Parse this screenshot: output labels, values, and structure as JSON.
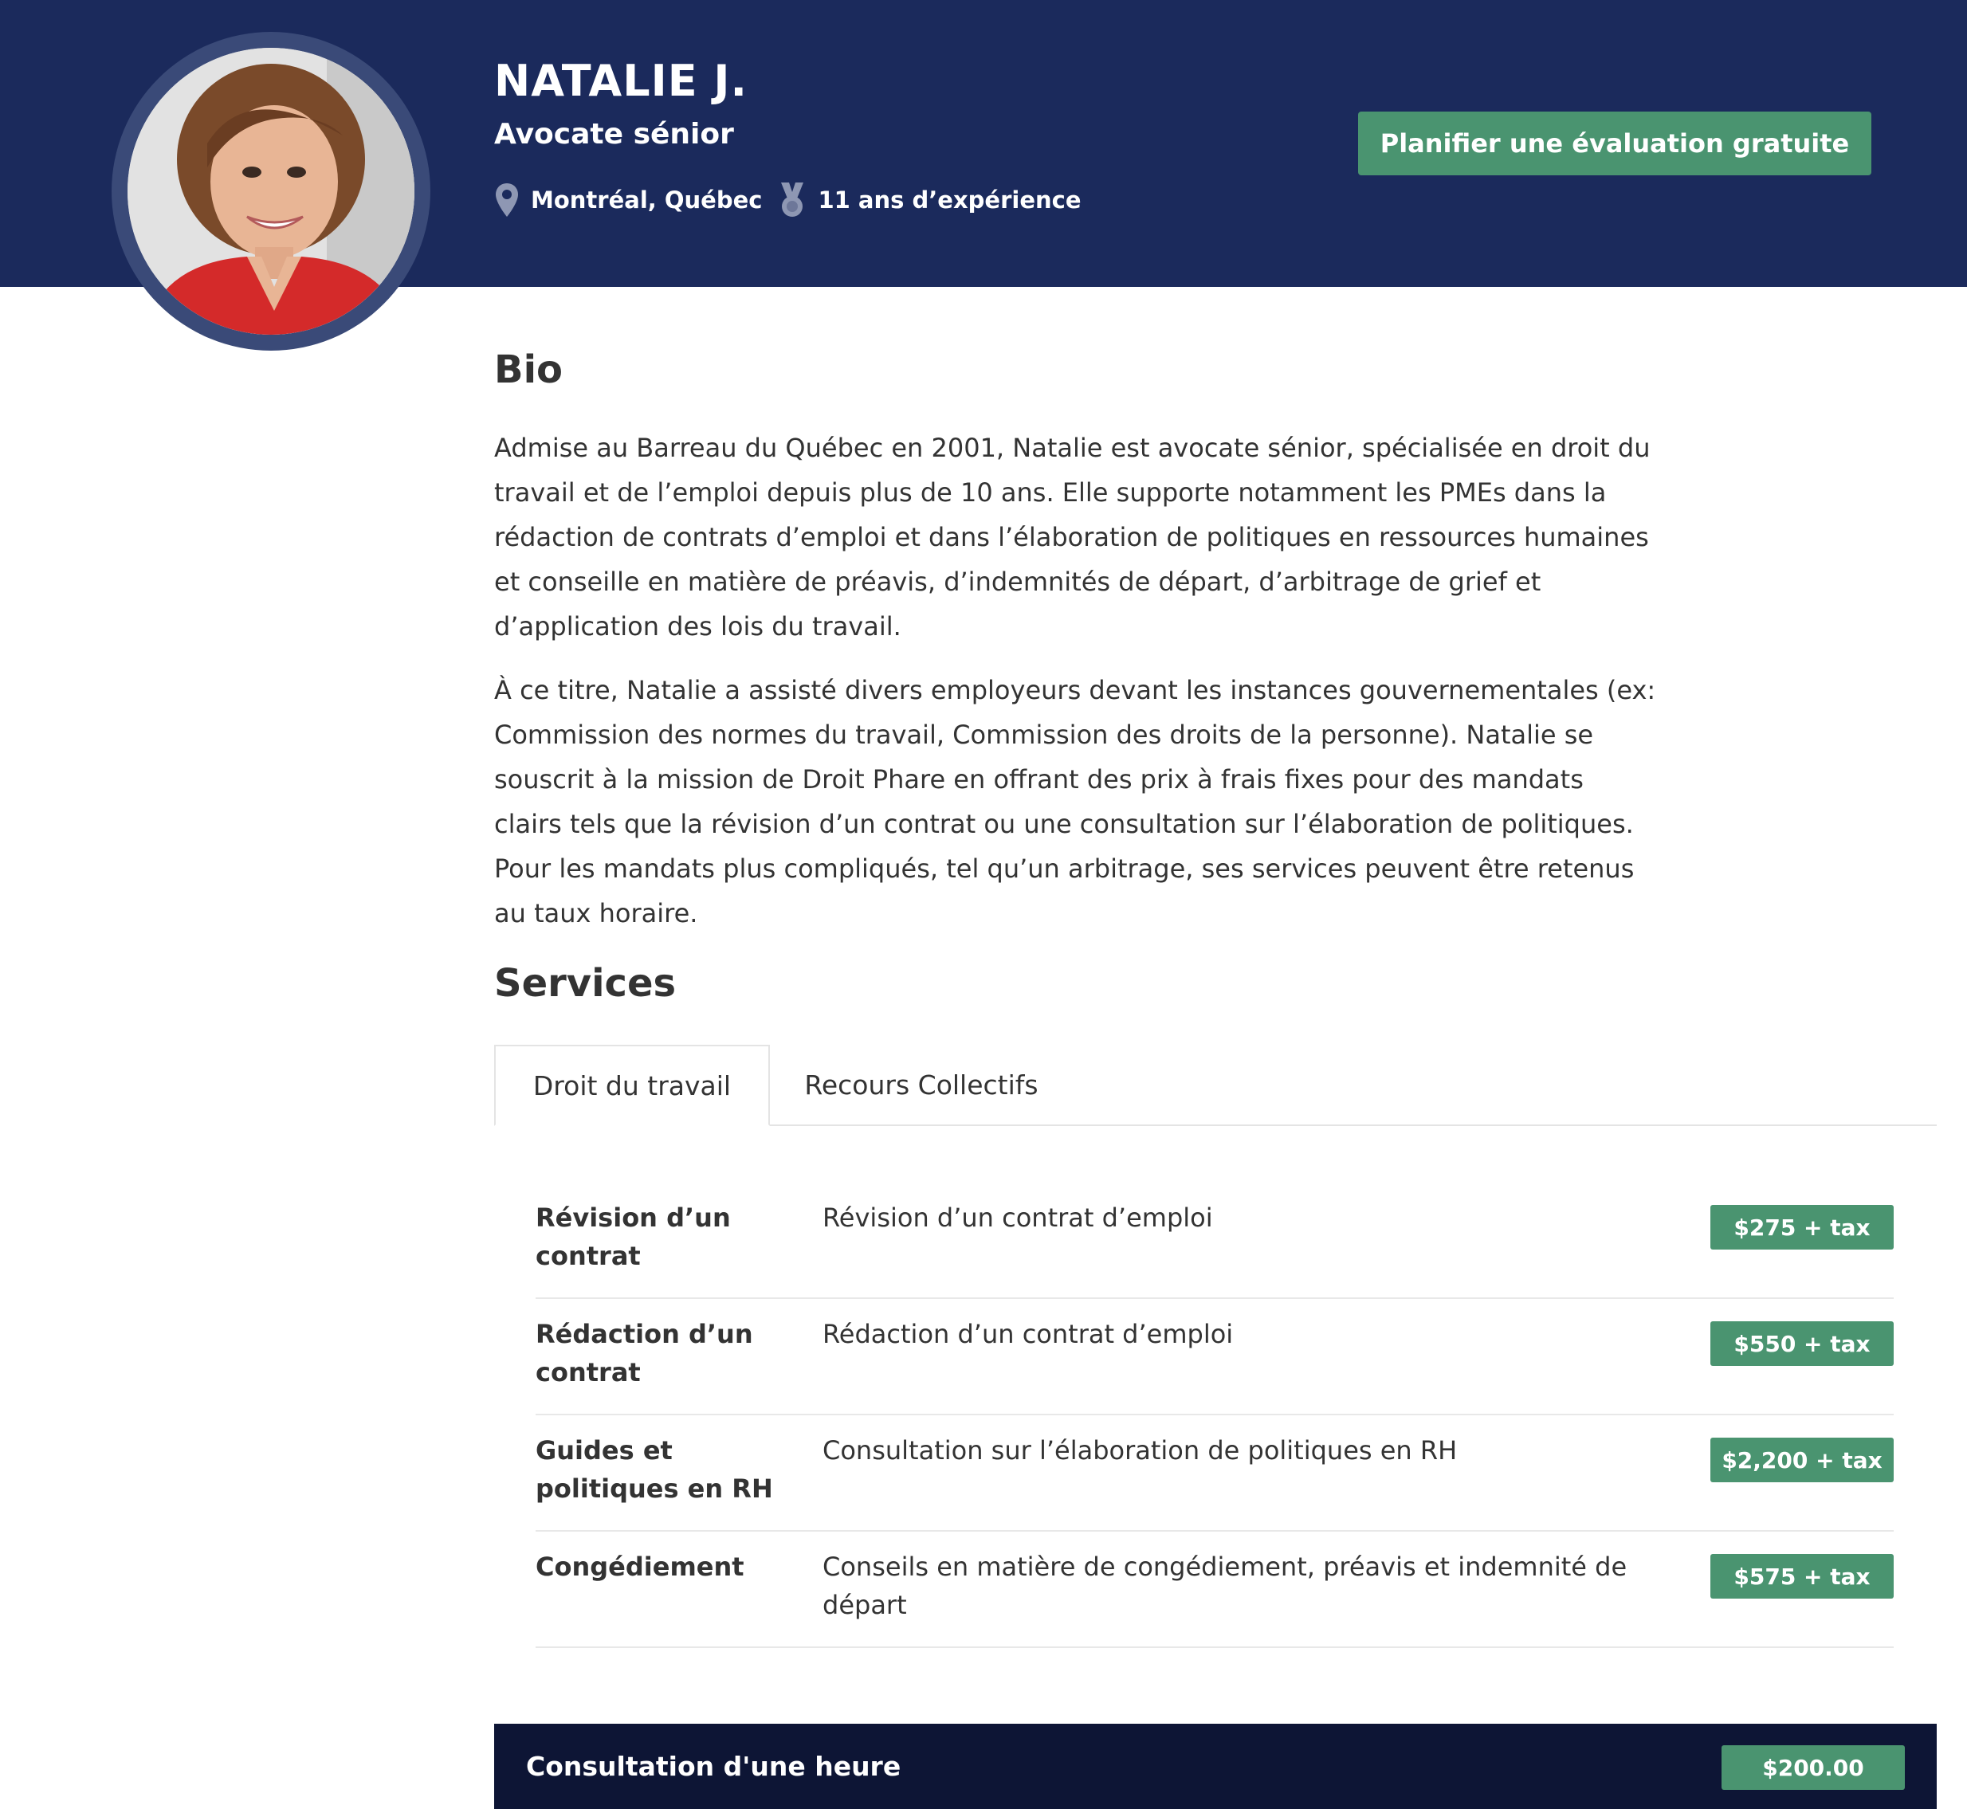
{
  "profile": {
    "name": "NATALIE J.",
    "title": "Avocate sénior",
    "location": "Montréal, Québec",
    "experience": "11 ans d’expérience",
    "cta_label": "Planifier une évaluation gratuite",
    "photo_icon": "avatar-photo",
    "location_icon": "map-pin-icon",
    "experience_icon": "medal-icon"
  },
  "bio": {
    "heading": "Bio",
    "paragraphs": [
      "Admise au Barreau du Québec en 2001, Natalie est avocate sénior, spécialisée en droit du travail et de l’emploi depuis plus de 10 ans. Elle supporte notamment les PMEs dans la rédaction de contrats d’emploi et dans l’élaboration de politiques en ressources humaines et conseille en matière de préavis, d’indemnités de départ, d’arbitrage de grief et d’application des lois du travail.",
      "À ce titre, Natalie a assisté divers employeurs devant les instances gouvernementales (ex: Commission des normes du travail, Commission des droits de la personne). Natalie se souscrit à la mission de Droit Phare en offrant des prix à frais fixes pour des mandats clairs tels que la révision d’un contrat ou une consultation sur l’élaboration de politiques. Pour les mandats plus compliqués, tel qu’un arbitrage, ses services peuvent être retenus au taux horaire."
    ]
  },
  "services": {
    "heading": "Services",
    "tabs": [
      {
        "label": "Droit du travail",
        "active": true
      },
      {
        "label": "Recours Collectifs",
        "active": false
      }
    ],
    "rows": [
      {
        "name": "Révision d’un contrat",
        "description": "Révision d’un contrat d’emploi",
        "price": "$275 + tax"
      },
      {
        "name": "Rédaction d’un contrat",
        "description": "Rédaction d’un contrat d’emploi",
        "price": "$550 + tax"
      },
      {
        "name": "Guides et politiques en RH",
        "description": "Consultation sur l’élaboration de politiques en RH",
        "price": "$2,200 + tax"
      },
      {
        "name": "Congédiement",
        "description": "Conseils en matière de congédiement, préavis et indemnité de départ",
        "price": "$575 + tax"
      }
    ]
  },
  "consultation": {
    "title": "Consultation d'une heure",
    "price": "$200.00"
  },
  "colors": {
    "header_bg": "#1b2a5c",
    "accent_green": "#4a9470",
    "consult_bg": "#0d1535",
    "text": "#333333"
  }
}
